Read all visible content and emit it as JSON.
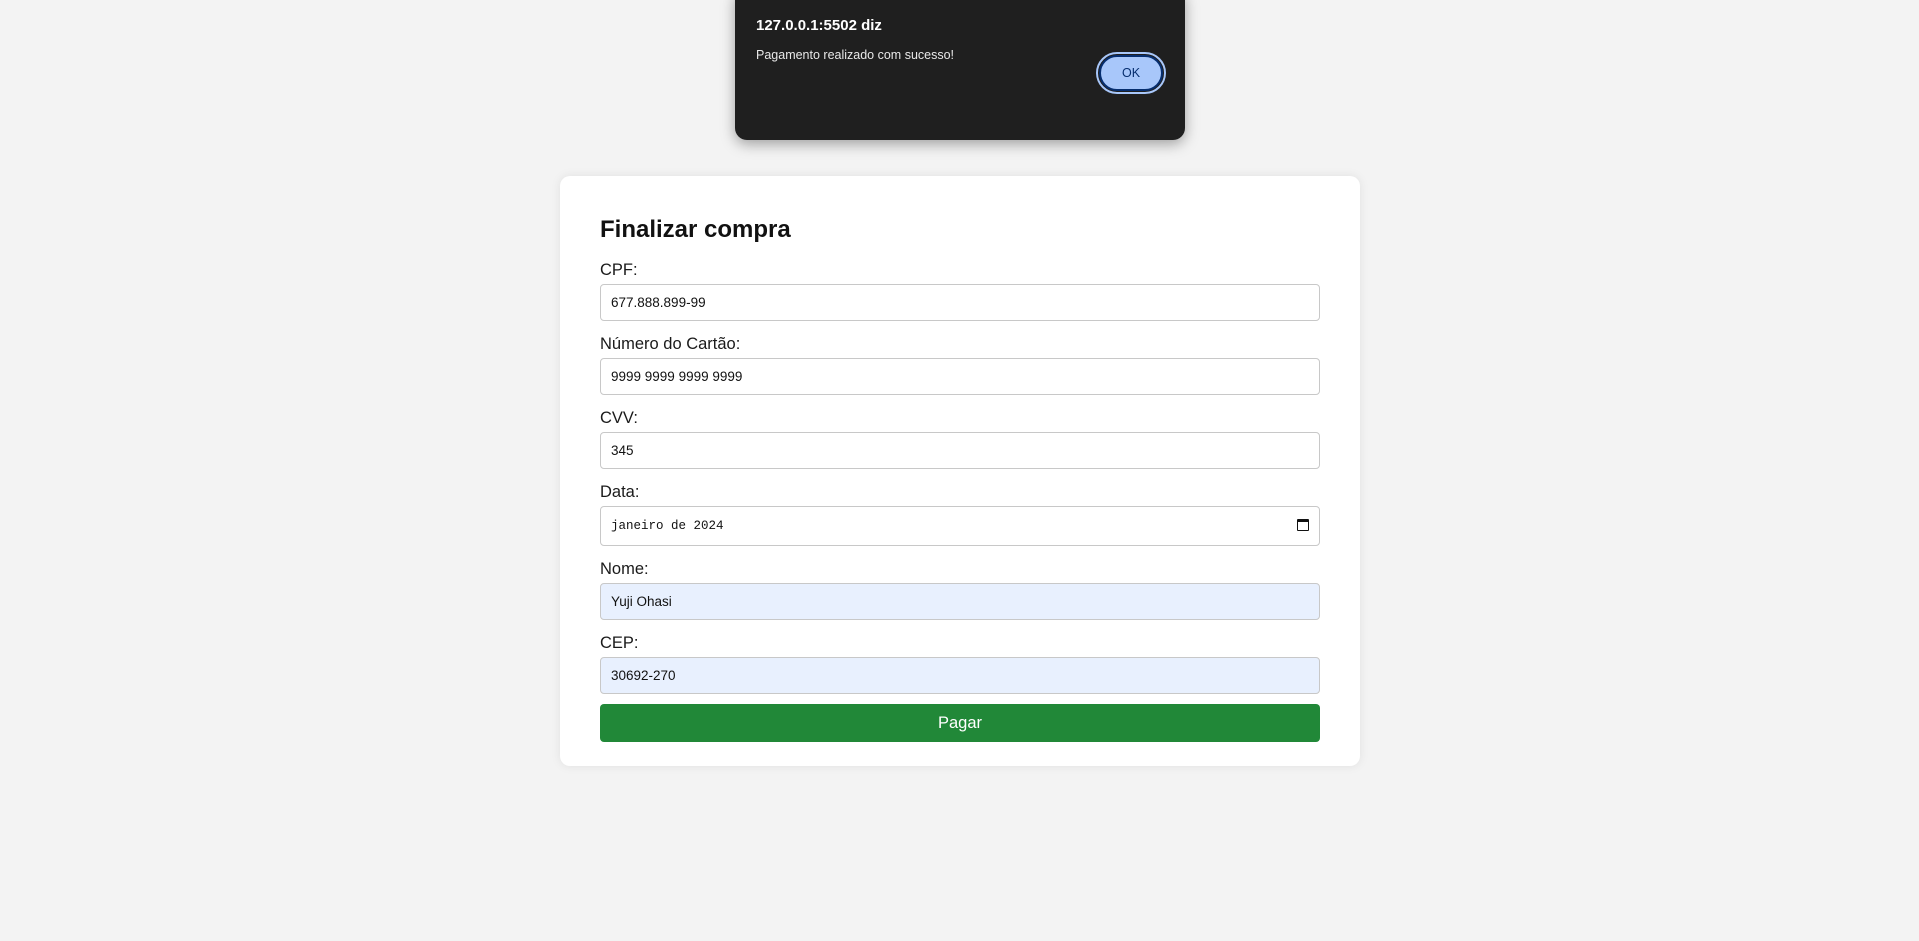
{
  "alert": {
    "title": "127.0.0.1:5502 diz",
    "message": "Pagamento realizado com sucesso!",
    "ok_label": "OK"
  },
  "form": {
    "title": "Finalizar compra",
    "cpf": {
      "label": "CPF:",
      "value": "677.888.899-99"
    },
    "card_number": {
      "label": "Número do Cartão:",
      "value": "9999 9999 9999 9999"
    },
    "cvv": {
      "label": "CVV:",
      "value": "345"
    },
    "date": {
      "label": "Data:",
      "value": "janeiro de 2024"
    },
    "name": {
      "label": "Nome:",
      "value": "Yuji Ohasi"
    },
    "cep": {
      "label": "CEP:",
      "value": "30692-270"
    },
    "submit_label": "Pagar"
  },
  "colors": {
    "page_background": "#f3f3f3",
    "alert_background": "#1f1f1f",
    "ok_button": "#a8c7fa",
    "pay_button": "#218838",
    "autofill_field": "#e8f0fe"
  }
}
